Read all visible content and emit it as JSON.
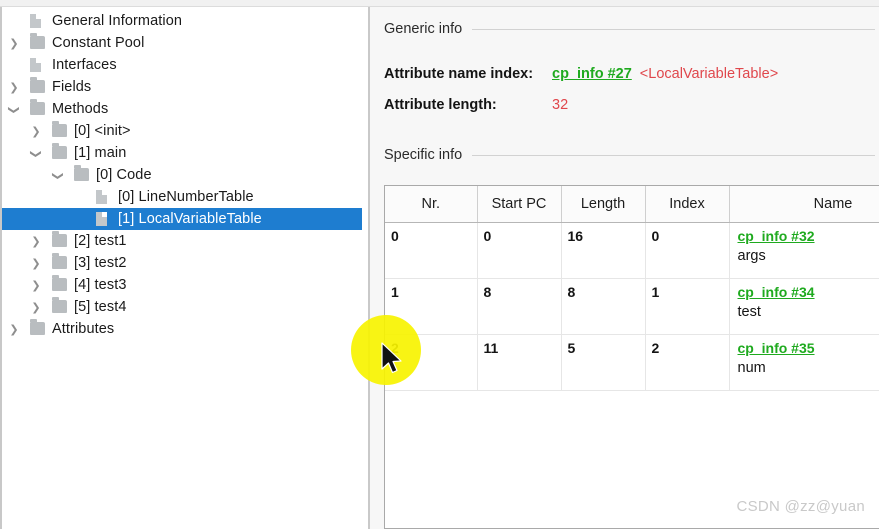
{
  "tree": {
    "items": [
      {
        "label": "General Information",
        "depth": 0,
        "twisty": "none",
        "icon": "document-icon",
        "selected": false
      },
      {
        "label": "Constant Pool",
        "depth": 0,
        "twisty": "collapsed",
        "icon": "folder-icon",
        "selected": false
      },
      {
        "label": "Interfaces",
        "depth": 0,
        "twisty": "none",
        "icon": "document-icon",
        "selected": false
      },
      {
        "label": "Fields",
        "depth": 0,
        "twisty": "collapsed",
        "icon": "folder-icon",
        "selected": false
      },
      {
        "label": "Methods",
        "depth": 0,
        "twisty": "expanded",
        "icon": "folder-icon",
        "selected": false
      },
      {
        "label": "[0] <init>",
        "depth": 1,
        "twisty": "collapsed",
        "icon": "folder-icon",
        "selected": false
      },
      {
        "label": "[1] main",
        "depth": 1,
        "twisty": "expanded",
        "icon": "folder-icon",
        "selected": false
      },
      {
        "label": "[0] Code",
        "depth": 2,
        "twisty": "expanded",
        "icon": "folder-icon",
        "selected": false
      },
      {
        "label": "[0] LineNumberTable",
        "depth": 3,
        "twisty": "none",
        "icon": "document-icon",
        "selected": false
      },
      {
        "label": "[1] LocalVariableTable",
        "depth": 3,
        "twisty": "none",
        "icon": "document-icon",
        "selected": true
      },
      {
        "label": "[2] test1",
        "depth": 1,
        "twisty": "collapsed",
        "icon": "folder-icon",
        "selected": false
      },
      {
        "label": "[3] test2",
        "depth": 1,
        "twisty": "collapsed",
        "icon": "folder-icon",
        "selected": false
      },
      {
        "label": "[4] test3",
        "depth": 1,
        "twisty": "collapsed",
        "icon": "folder-icon",
        "selected": false
      },
      {
        "label": "[5] test4",
        "depth": 1,
        "twisty": "collapsed",
        "icon": "folder-icon",
        "selected": false
      },
      {
        "label": "Attributes",
        "depth": 0,
        "twisty": "collapsed",
        "icon": "folder-icon",
        "selected": false
      }
    ]
  },
  "detail": {
    "generic_section_title": "Generic info",
    "specific_section_title": "Specific info",
    "attribute_name_index": {
      "key": "Attribute name index:",
      "link": "cp_info #27",
      "resolved": "<LocalVariableTable>"
    },
    "attribute_length": {
      "key": "Attribute length:",
      "value": "32"
    }
  },
  "table": {
    "columns": [
      "Nr.",
      "Start PC",
      "Length",
      "Index",
      "Name"
    ],
    "rows": [
      {
        "nr": "0",
        "start_pc": "0",
        "length": "16",
        "index": "0",
        "name_link": "cp_info #32",
        "name_text": "args"
      },
      {
        "nr": "1",
        "start_pc": "8",
        "length": "8",
        "index": "1",
        "name_link": "cp_info #34",
        "name_text": "test"
      },
      {
        "nr": "2",
        "start_pc": "11",
        "length": "5",
        "index": "2",
        "name_link": "cp_info #35",
        "name_text": "num"
      }
    ]
  },
  "watermark": {
    "text": "CSDN @zz@yuan"
  },
  "colors": {
    "selection_blue": "#1e7dd0",
    "link_green": "#1faa1f",
    "value_red": "#e0474c",
    "highlight_yellow": "#f7f300",
    "panel_bg": "#f7f7f7"
  }
}
